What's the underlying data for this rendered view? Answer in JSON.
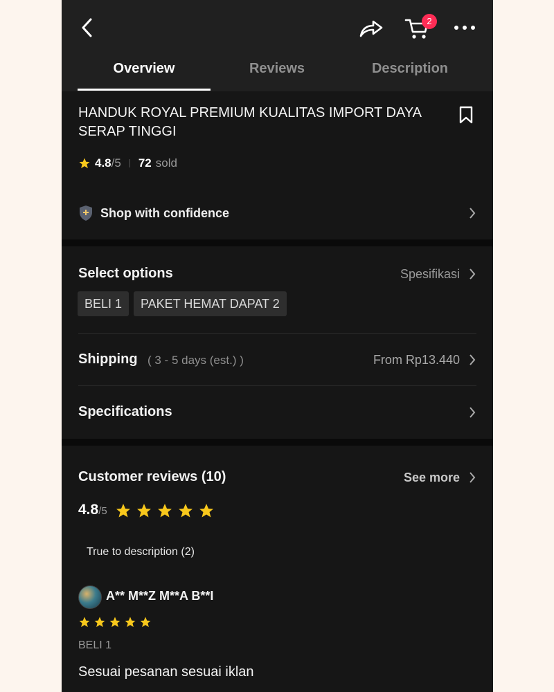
{
  "header": {
    "cart_count": "2",
    "tabs": [
      {
        "label": "Overview",
        "active": true
      },
      {
        "label": "Reviews",
        "active": false
      },
      {
        "label": "Description",
        "active": false
      }
    ]
  },
  "product": {
    "title": "HANDUK ROYAL PREMIUM KUALITAS IMPORT DAYA SERAP TINGGI",
    "rating": "4.8",
    "rating_denominator": "/5",
    "sold_count": "72",
    "sold_label": "sold"
  },
  "confidence": {
    "label": "Shop with confidence"
  },
  "options": {
    "title": "Select options",
    "right_label": "Spesifikasi",
    "chips": [
      "BELI 1",
      "PAKET HEMAT DAPAT 2"
    ]
  },
  "shipping": {
    "title": "Shipping",
    "subtitle": "( 3 - 5 days (est.) )",
    "price": "From Rp13.440"
  },
  "specifications": {
    "title": "Specifications"
  },
  "reviews": {
    "title": "Customer reviews (10)",
    "see_more": "See more",
    "score": "4.8",
    "score_denominator": "/5",
    "stars": 5,
    "filter": "True to description (2)",
    "items": [
      {
        "reviewer": "A** M**Z M**A B**I",
        "stars": 5,
        "variant": "BELI 1",
        "text": "Sesuai pesanan sesuai iklan"
      }
    ]
  },
  "colors": {
    "background": "#161616",
    "header": "#202020",
    "star": "#f8c81c",
    "badge": "#fe2c55"
  }
}
